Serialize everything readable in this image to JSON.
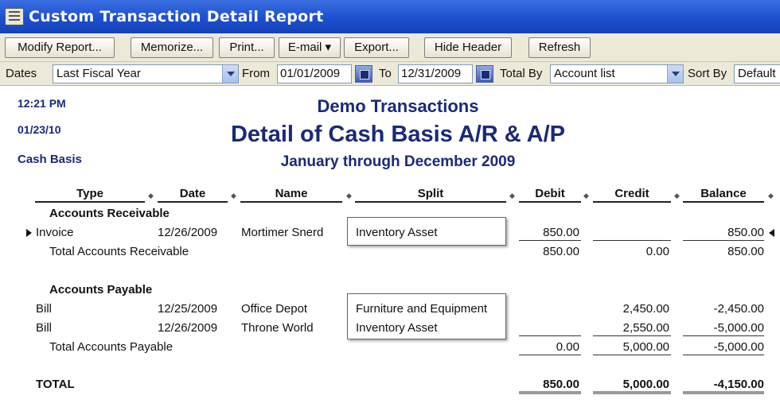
{
  "window": {
    "title": "Custom Transaction Detail Report"
  },
  "toolbar": {
    "modify": "Modify Report...",
    "memorize": "Memorize...",
    "print": "Print...",
    "email": "E-mail ▾",
    "export": "Export...",
    "hide_header": "Hide Header",
    "refresh": "Refresh"
  },
  "filters": {
    "dates_label": "Dates",
    "dates_value": "Last Fiscal Year",
    "from_label": "From",
    "from_value": "01/01/2009",
    "to_label": "To",
    "to_value": "12/31/2009",
    "total_by_label": "Total By",
    "total_by_value": "Account list",
    "sort_by_label": "Sort By",
    "sort_by_value": "Default"
  },
  "report": {
    "time": "12:21 PM",
    "date": "01/23/10",
    "basis": "Cash Basis",
    "company": "Demo Transactions",
    "title": "Detail of Cash Basis A/R & A/P",
    "period": "January through December 2009",
    "columns": [
      "Type",
      "Date",
      "Name",
      "Split",
      "Debit",
      "Credit",
      "Balance"
    ],
    "ar": {
      "header": "Accounts Receivable",
      "rows": [
        {
          "type": "Invoice",
          "date": "12/26/2009",
          "name": "Mortimer Snerd",
          "split": "Inventory Asset",
          "debit": "850.00",
          "credit": "",
          "balance": "850.00"
        }
      ],
      "total_label": "Total Accounts Receivable",
      "total_debit": "850.00",
      "total_credit": "0.00",
      "total_balance": "850.00"
    },
    "ap": {
      "header": "Accounts Payable",
      "rows": [
        {
          "type": "Bill",
          "date": "12/25/2009",
          "name": "Office Depot",
          "split": "Furniture and Equipment",
          "debit": "",
          "credit": "2,450.00",
          "balance": "-2,450.00"
        },
        {
          "type": "Bill",
          "date": "12/26/2009",
          "name": "Throne World",
          "split": "Inventory Asset",
          "debit": "",
          "credit": "2,550.00",
          "balance": "-5,000.00"
        }
      ],
      "total_label": "Total Accounts Payable",
      "total_debit": "0.00",
      "total_credit": "5,000.00",
      "total_balance": "-5,000.00"
    },
    "grand_total": {
      "label": "TOTAL",
      "debit": "850.00",
      "credit": "5,000.00",
      "balance": "-4,150.00"
    }
  }
}
